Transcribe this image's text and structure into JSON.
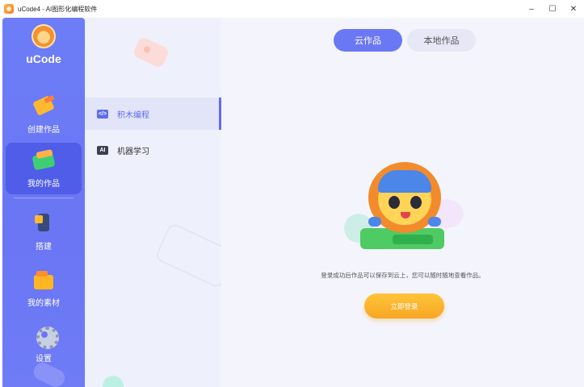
{
  "window": {
    "title": "uCode4 - AI图形化编程软件",
    "controls": {
      "minimize": "–",
      "maximize": "☐",
      "close": "✕"
    }
  },
  "brand": {
    "name": "uCode"
  },
  "nav": {
    "items": [
      {
        "label": "创建作品",
        "icon": "create-icon"
      },
      {
        "label": "我的作品",
        "icon": "my-works-icon",
        "active": true
      },
      {
        "label": "搭建",
        "icon": "build-icon"
      },
      {
        "label": "我的素材",
        "icon": "assets-icon"
      },
      {
        "label": "设置",
        "icon": "gear-icon"
      }
    ]
  },
  "subnav": {
    "items": [
      {
        "label": "积木编程",
        "icon_text": "</>",
        "active": true
      },
      {
        "label": "机器学习",
        "icon_text": "AI"
      }
    ]
  },
  "tabs": [
    {
      "label": "云作品",
      "active": true
    },
    {
      "label": "本地作品"
    }
  ],
  "main": {
    "message": "登录成功后作品可以保存到云上，您可以随时随地查看作品。",
    "login_button": "立即登录"
  },
  "colors": {
    "nav_bg": "#6d7df7",
    "nav_active": "#4f5de8",
    "accent": "#6b78f3",
    "button": "#f7a624"
  }
}
